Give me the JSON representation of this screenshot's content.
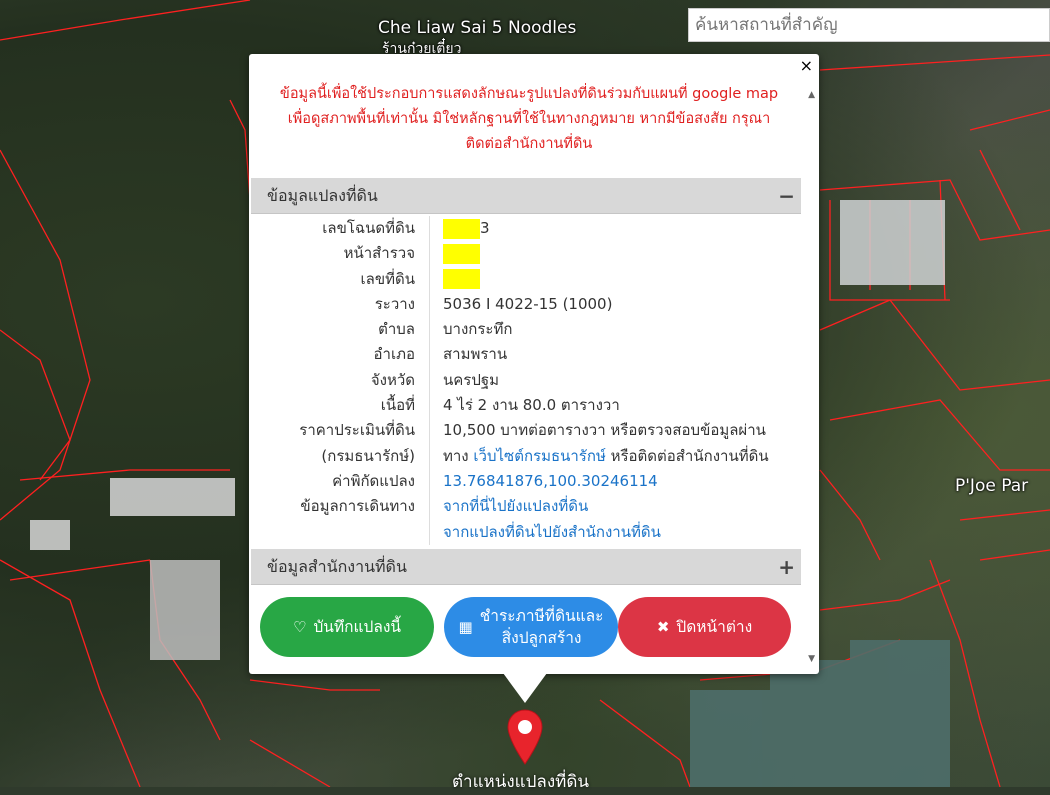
{
  "map": {
    "poi_top": "Che Liaw Sai 5 Noodles",
    "poi_top_sub": "ร้านก๋วยเตี๋ยว",
    "poi_right": "P'Joe Par",
    "pin_label": "ตำแหน่งแปลงที่ดิน"
  },
  "search": {
    "placeholder": "ค้นหาสถานที่สำคัญ"
  },
  "popup": {
    "close_glyph": "×",
    "disclaimer_lines": [
      "ข้อมูลนี้เพื่อใช้ประกอบการแสดงลักษณะรูปแปลงที่ดินร่วมกับแผนที่ google map",
      "เพื่อดูสภาพพื้นที่เท่านั้น มิใช่หลักฐานที่ใช้ในทางกฎหมาย หากมีข้อสงสัย กรุณา",
      "ติดต่อสำนักงานที่ดิน"
    ],
    "section1": {
      "title": "ข้อมูลแปลงที่ดิน",
      "sign": "−"
    },
    "section2": {
      "title": "ข้อมูลสำนักงานที่ดิน",
      "sign": "+"
    },
    "fields": {
      "deed_no": {
        "label": "เลขโฉนดที่ดิน",
        "value_suffix": "3"
      },
      "survey_page": {
        "label": "หน้าสำรวจ"
      },
      "parcel_no": {
        "label": "เลขที่ดิน"
      },
      "sheet": {
        "label": "ระวาง",
        "value": "5036 I 4022-15 (1000)"
      },
      "subdistrict": {
        "label": "ตำบล",
        "value": "บางกระทึก"
      },
      "district": {
        "label": "อำเภอ",
        "value": "สามพราน"
      },
      "province": {
        "label": "จังหวัด",
        "value": "นครปฐม"
      },
      "area": {
        "label": "เนื้อที่",
        "value": "4 ไร่ 2 งาน 80.0 ตารางวา"
      },
      "price": {
        "label": "ราคาประเมินที่ดิน",
        "label2": "(กรมธนารักษ์)",
        "value_line1": "10,500 บาทต่อตารางวา หรือตรวจสอบข้อมูลผ่าน",
        "value_line2_pre": "ทาง ",
        "value_line2_link": "เว็บไซต์กรมธนารักษ์",
        "value_line2_post": " หรือติดต่อสำนักงานที่ดิน"
      },
      "coords": {
        "label": "ค่าพิกัดแปลง",
        "value": "13.76841876,100.30246114"
      },
      "travel": {
        "label": "ข้อมูลการเดินทาง",
        "link1": "จากที่นี่ไปยังแปลงที่ดิน",
        "link2": "จากแปลงที่ดินไปยังสำนักงานที่ดิน"
      }
    },
    "buttons": {
      "save": "บันทึกแปลงนี้",
      "tax_line1": "ชำระภาษีที่ดินและ",
      "tax_line2": "สิ่งปลูกสร้าง",
      "close": "ปิดหน้าต่าง"
    },
    "colors": {
      "save": "#28a745",
      "tax": "#2d8ce6",
      "close": "#dc3545",
      "disclaimer": "#e02020",
      "link": "#1a73c8",
      "redaction": "#ffff00"
    }
  }
}
